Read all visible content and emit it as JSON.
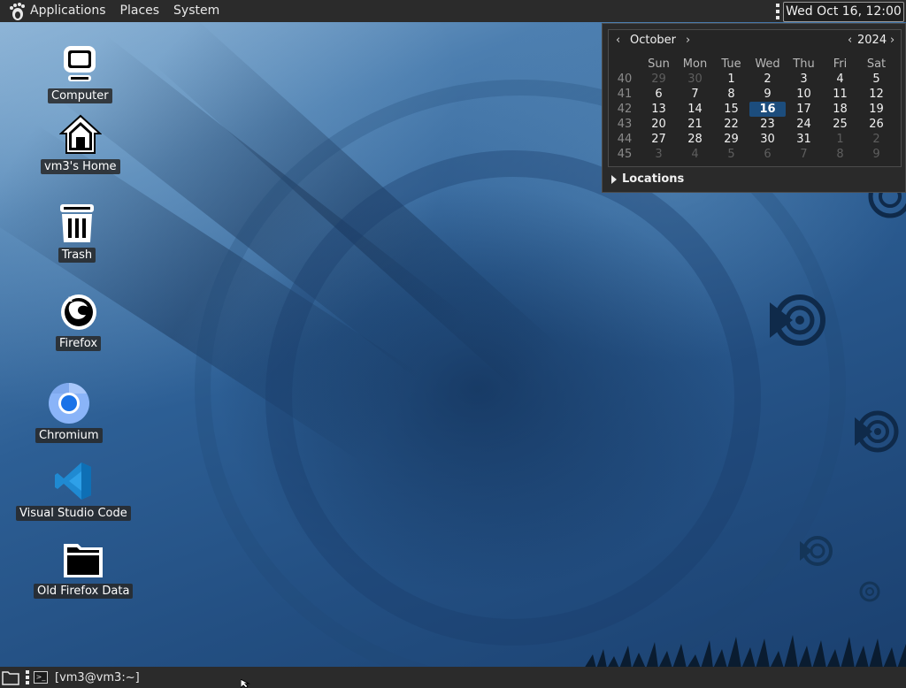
{
  "top_panel": {
    "menus": {
      "applications": "Applications",
      "places": "Places",
      "system": "System"
    },
    "clock": "Wed Oct 16, 12:00 PM"
  },
  "calendar": {
    "prev_month_glyph": "‹",
    "next_month_glyph": "›",
    "month": "October",
    "prev_year_glyph": "‹",
    "next_year_glyph": "›",
    "year": "2024",
    "weekdays": [
      "Sun",
      "Mon",
      "Tue",
      "Wed",
      "Thu",
      "Fri",
      "Sat"
    ],
    "weeks": [
      {
        "week": "40",
        "days": [
          {
            "d": "29",
            "dim": true
          },
          {
            "d": "30",
            "dim": true
          },
          {
            "d": "1"
          },
          {
            "d": "2"
          },
          {
            "d": "3"
          },
          {
            "d": "4"
          },
          {
            "d": "5"
          }
        ]
      },
      {
        "week": "41",
        "days": [
          {
            "d": "6"
          },
          {
            "d": "7"
          },
          {
            "d": "8"
          },
          {
            "d": "9"
          },
          {
            "d": "10"
          },
          {
            "d": "11"
          },
          {
            "d": "12"
          }
        ]
      },
      {
        "week": "42",
        "days": [
          {
            "d": "13"
          },
          {
            "d": "14"
          },
          {
            "d": "15"
          },
          {
            "d": "16",
            "today": true
          },
          {
            "d": "17"
          },
          {
            "d": "18"
          },
          {
            "d": "19"
          }
        ]
      },
      {
        "week": "43",
        "days": [
          {
            "d": "20"
          },
          {
            "d": "21"
          },
          {
            "d": "22"
          },
          {
            "d": "23"
          },
          {
            "d": "24"
          },
          {
            "d": "25"
          },
          {
            "d": "26"
          }
        ]
      },
      {
        "week": "44",
        "days": [
          {
            "d": "27"
          },
          {
            "d": "28"
          },
          {
            "d": "29"
          },
          {
            "d": "30"
          },
          {
            "d": "31"
          },
          {
            "d": "1",
            "dim": true
          },
          {
            "d": "2",
            "dim": true
          }
        ]
      },
      {
        "week": "45",
        "days": [
          {
            "d": "3",
            "dim": true
          },
          {
            "d": "4",
            "dim": true
          },
          {
            "d": "5",
            "dim": true
          },
          {
            "d": "6",
            "dim": true
          },
          {
            "d": "7",
            "dim": true
          },
          {
            "d": "8",
            "dim": true
          },
          {
            "d": "9",
            "dim": true
          }
        ]
      }
    ],
    "locations_label": "Locations",
    "today_color": "#1c4d7d"
  },
  "desktop_icons": {
    "computer": {
      "label": "Computer",
      "icon": "computer-icon"
    },
    "home": {
      "label": "vm3's Home",
      "icon": "home-icon"
    },
    "trash": {
      "label": "Trash",
      "icon": "trash-icon"
    },
    "firefox": {
      "label": "Firefox",
      "icon": "firefox-icon"
    },
    "chromium": {
      "label": "Chromium",
      "icon": "chromium-icon"
    },
    "vscode": {
      "label": "Visual Studio Code",
      "icon": "vscode-icon"
    },
    "old_firefox_data": {
      "label": "Old Firefox Data",
      "icon": "folder-icon"
    }
  },
  "bottom_panel": {
    "task_terminal": "[vm3@vm3:~]"
  }
}
